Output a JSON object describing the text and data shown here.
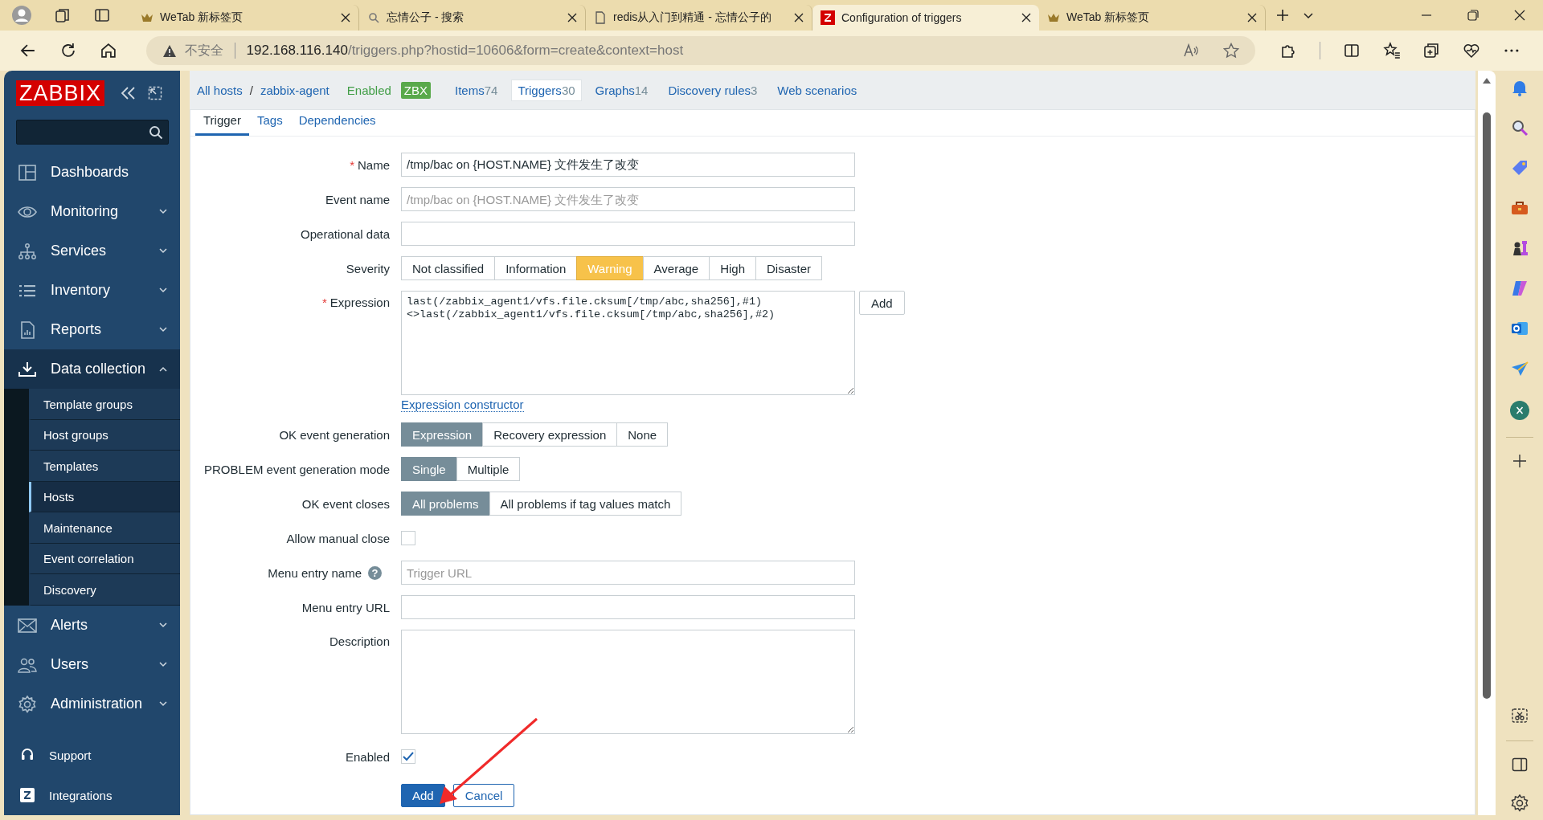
{
  "browser": {
    "tabs": [
      {
        "title": "WeTab 新标签页",
        "kind": "wetab",
        "selected": false
      },
      {
        "title": "忘情公子 - 搜索",
        "kind": "search",
        "selected": false
      },
      {
        "title": "redis从入门到精通 - 忘情公子的",
        "kind": "page",
        "selected": false
      },
      {
        "title": "Configuration of triggers",
        "kind": "zabbix",
        "selected": true
      },
      {
        "title": "WeTab 新标签页",
        "kind": "wetab",
        "selected": false
      }
    ],
    "security": "不安全",
    "url_host": "192.168.116.140",
    "url_path": "/triggers.php?hostid=10606&form=create&context=host"
  },
  "sidebar": {
    "logo": "ZABBIX",
    "menu": [
      {
        "label": "Dashboards",
        "kind": "link",
        "expanded": false
      },
      {
        "label": "Monitoring",
        "kind": "group",
        "expanded": false
      },
      {
        "label": "Services",
        "kind": "group",
        "expanded": false
      },
      {
        "label": "Inventory",
        "kind": "group",
        "expanded": false
      },
      {
        "label": "Reports",
        "kind": "group",
        "expanded": false
      },
      {
        "label": "Data collection",
        "kind": "group",
        "expanded": true,
        "children": [
          {
            "label": "Template groups",
            "selected": false
          },
          {
            "label": "Host groups",
            "selected": false
          },
          {
            "label": "Templates",
            "selected": false
          },
          {
            "label": "Hosts",
            "selected": true
          },
          {
            "label": "Maintenance",
            "selected": false
          },
          {
            "label": "Event correlation",
            "selected": false
          },
          {
            "label": "Discovery",
            "selected": false
          }
        ]
      },
      {
        "label": "Alerts",
        "kind": "group",
        "expanded": false
      },
      {
        "label": "Users",
        "kind": "group",
        "expanded": false
      },
      {
        "label": "Administration",
        "kind": "group",
        "expanded": false
      }
    ],
    "footer": [
      "Support",
      "Integrations"
    ]
  },
  "host_nav": {
    "breadcrumbs": [
      "All hosts",
      "zabbix-agent"
    ],
    "separator": "/",
    "status": "Enabled",
    "badge": "ZBX",
    "links": [
      {
        "label": "Items",
        "count": "74",
        "selected": false
      },
      {
        "label": "Triggers",
        "count": "30",
        "selected": true
      },
      {
        "label": "Graphs",
        "count": "14",
        "selected": false
      },
      {
        "label": "Discovery rules",
        "count": "3",
        "selected": false
      },
      {
        "label": "Web scenarios",
        "selected": false
      }
    ]
  },
  "form_tabs": [
    {
      "label": "Trigger",
      "selected": true
    },
    {
      "label": "Tags",
      "selected": false
    },
    {
      "label": "Dependencies",
      "selected": false
    }
  ],
  "fields": [
    {
      "kind": "text",
      "label": "Name",
      "required": true,
      "value": "/tmp/bac on {HOST.NAME} 文件发生了改变"
    },
    {
      "kind": "text",
      "label": "Event name",
      "required": false,
      "placeholder": "/tmp/bac on {HOST.NAME} 文件发生了改变"
    },
    {
      "kind": "text",
      "label": "Operational data",
      "required": false
    },
    {
      "kind": "severity",
      "label": "Severity",
      "required": false,
      "options": [
        {
          "label": "Not classified",
          "selected": false
        },
        {
          "label": "Information",
          "selected": false
        },
        {
          "label": "Warning",
          "selected": true
        },
        {
          "label": "Average",
          "selected": false
        },
        {
          "label": "High",
          "selected": false
        },
        {
          "label": "Disaster",
          "selected": false
        }
      ]
    },
    {
      "kind": "expression",
      "label": "Expression",
      "required": true,
      "value": "last(/zabbix_agent1/vfs.file.cksum[/tmp/abc,sha256],#1)\n<>last(/zabbix_agent1/vfs.file.cksum[/tmp/abc,sha256],#2)",
      "button": "Add",
      "link": "Expression constructor"
    },
    {
      "kind": "segmented",
      "label": "OK event generation",
      "required": false,
      "options": [
        {
          "label": "Expression",
          "selected": true
        },
        {
          "label": "Recovery expression",
          "selected": false
        },
        {
          "label": "None",
          "selected": false
        }
      ]
    },
    {
      "kind": "segmented",
      "label": "PROBLEM event generation mode",
      "required": false,
      "options": [
        {
          "label": "Single",
          "selected": true
        },
        {
          "label": "Multiple",
          "selected": false
        }
      ]
    },
    {
      "kind": "segmented",
      "label": "OK event closes",
      "required": false,
      "options": [
        {
          "label": "All problems",
          "selected": true
        },
        {
          "label": "All problems if tag values match",
          "selected": false
        }
      ]
    },
    {
      "kind": "checkbox",
      "label": "Allow manual close",
      "required": false,
      "checked": false
    },
    {
      "kind": "text",
      "label": "Menu entry name",
      "required": false,
      "help": "?",
      "placeholder": "Trigger URL"
    },
    {
      "kind": "text",
      "label": "Menu entry URL",
      "required": false
    },
    {
      "kind": "textarea",
      "label": "Description",
      "required": false
    },
    {
      "kind": "checkbox",
      "label": "Enabled",
      "required": false,
      "checked": true
    }
  ],
  "required_mark": "*",
  "buttons": [
    {
      "label": "Add",
      "kind": "primary"
    },
    {
      "label": "Cancel",
      "kind": "secondary"
    }
  ]
}
